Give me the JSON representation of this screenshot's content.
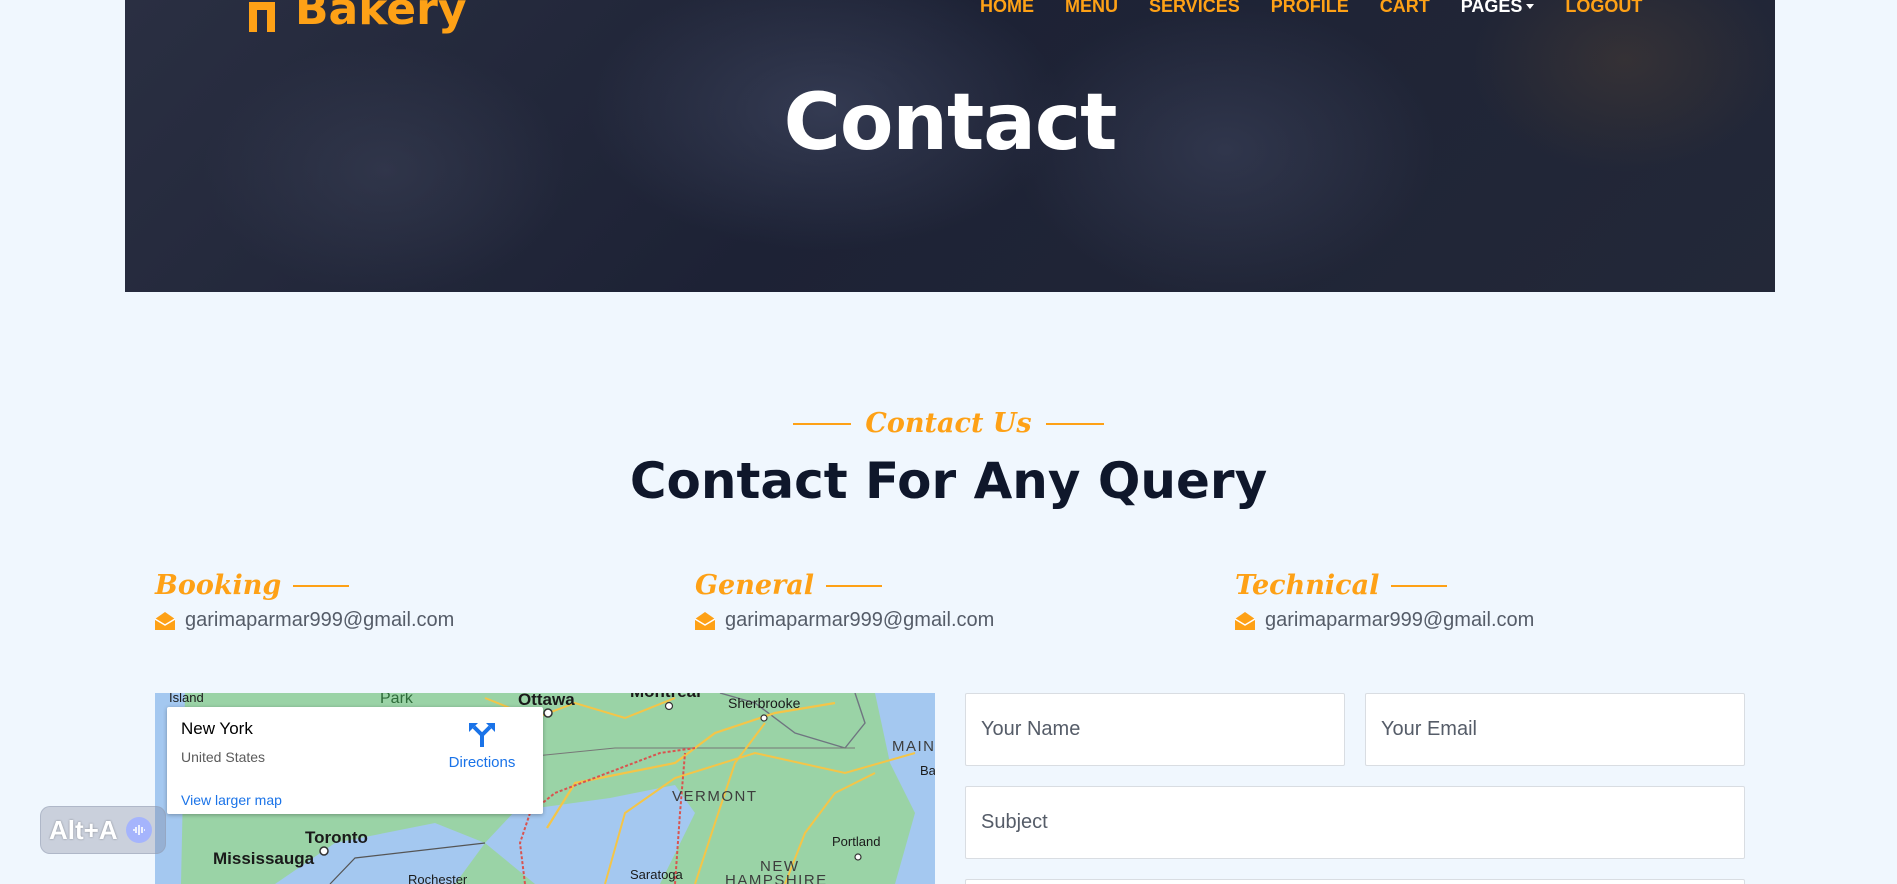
{
  "brand": {
    "name": "Bakery"
  },
  "nav": [
    {
      "label": "HOME"
    },
    {
      "label": "MENU"
    },
    {
      "label": "SERVICES"
    },
    {
      "label": "PROFILE"
    },
    {
      "label": "CART"
    },
    {
      "label": "PAGES"
    },
    {
      "label": "LOGOUT"
    }
  ],
  "hero": {
    "title": "Contact"
  },
  "section": {
    "subtitle": "Contact Us",
    "title": "Contact For Any Query"
  },
  "contacts": [
    {
      "heading": "Booking",
      "email": "garimaparmar999@gmail.com"
    },
    {
      "heading": "General",
      "email": "garimaparmar999@gmail.com"
    },
    {
      "heading": "Technical",
      "email": "garimaparmar999@gmail.com"
    }
  ],
  "map": {
    "place": "New York",
    "country": "United States",
    "directions": "Directions",
    "larger": "View larger map",
    "labels": {
      "island": "Island",
      "park": "Park",
      "ottawa": "Ottawa",
      "montreal": "Montreal",
      "sherbrooke": "Sherbrooke",
      "maine": "MAIN",
      "ba": "Ba",
      "vermont": "VERMONT",
      "toronto": "Toronto",
      "mississauga": "Mississauga",
      "portland": "Portland",
      "new": "NEW",
      "hampshire": "HAMPSHIRE",
      "rochester": "Rochester",
      "saratoga": "Saratoga"
    }
  },
  "form": {
    "name_placeholder": "Your Name",
    "email_placeholder": "Your Email",
    "subject_placeholder": "Subject"
  },
  "overlay": {
    "shortcut": "Alt+A"
  },
  "colors": {
    "accent": "#fea116",
    "dark": "#0f172b",
    "background": "#f0f7fe"
  }
}
